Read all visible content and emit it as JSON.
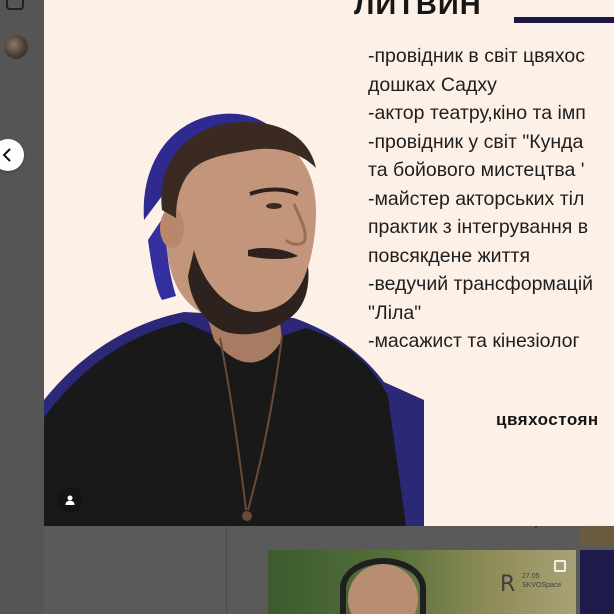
{
  "post": {
    "name_title": "ЛИТВИН",
    "bio_lines": [
      "-провідник в світ цвяхос",
      "дошках Садху",
      "-актор театру,кіно та імп",
      "-провідник у світ \"Кунда",
      "та бойового мистецтва '",
      "-майстер акторських тіл",
      "практик з інтегрування в",
      "повсякдене життя",
      "-ведучий трансформацій",
      "\"Ліла\"",
      "-масажист та кінезіолог"
    ],
    "hashtag": "цвяхостоян",
    "icons": {
      "tag": "person-tag-icon",
      "prev": "chevron-left-icon"
    }
  },
  "background": {
    "thumb_logo": "R",
    "thumb_date": "27.05",
    "thumb_brand": "SKVOSpace"
  },
  "colors": {
    "post_bg": "#fdf1e7",
    "accent_navy": "#1a1846",
    "overlay": "#5a5a5a"
  }
}
